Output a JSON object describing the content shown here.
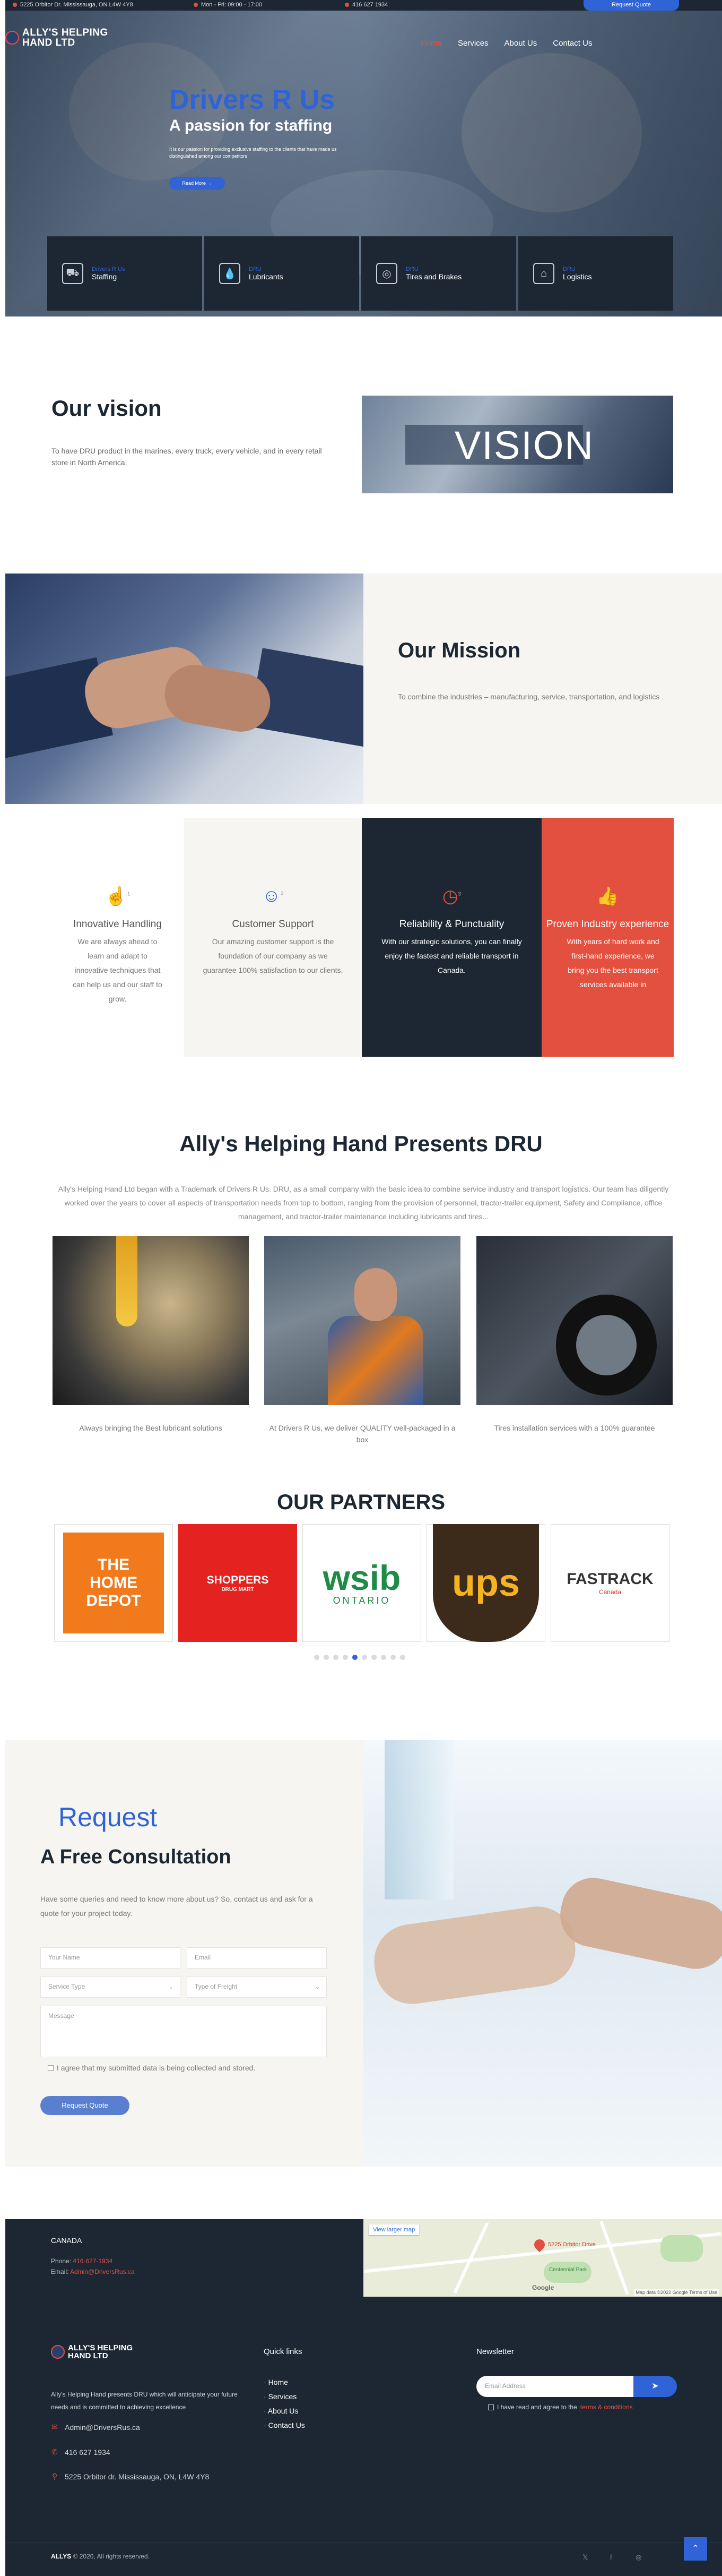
{
  "topbar": {
    "address": "5225 Orbitor Dr. Mississauga, ON L4W 4Y8",
    "hours": "Mon - Fri: 09:00 - 17:00",
    "phone": "416 627 1934",
    "quote_button": "Request Quote"
  },
  "header": {
    "logo_line1": "ALLY'S HELPING",
    "logo_line2": "HAND LTD",
    "nav": [
      "Home",
      "Services",
      "About Us",
      "Contact Us"
    ],
    "active_nav": "Home"
  },
  "hero": {
    "brand": "Drivers R Us",
    "tagline": "A passion for staffing",
    "description": "It is our passion for providing exclusive staffing to the clients that have made us distinguished among our competitors",
    "button": "Read More  →"
  },
  "services": [
    {
      "kicker": "Drivers R Us",
      "name": "Staffing",
      "icon": "truck-icon"
    },
    {
      "kicker": "DRU",
      "name": "Lubricants",
      "icon": "oil-drop-icon"
    },
    {
      "kicker": "DRU",
      "name": "Tires and Brakes",
      "icon": "tire-icon"
    },
    {
      "kicker": "DRU",
      "name": "Logistics",
      "icon": "warehouse-icon"
    }
  ],
  "vision": {
    "title": "Our vision",
    "text": "To have DRU product in the marines, every truck, every vehicle, and in every retail store in North America.",
    "image_word": "VISION"
  },
  "mission": {
    "title": "Our Mission",
    "text": "To combine the industries – manufacturing, service, transportation, and logistics ."
  },
  "features": [
    {
      "title": "Innovative Handling",
      "text": "We are always ahead to learn and adapt to innovative techniques that can help us and our staff to grow.",
      "icon": "hand-icon",
      "number": "1"
    },
    {
      "title": "Customer Support",
      "text": "Our amazing customer support is the foundation of our company as we guarantee 100% satisfaction to our clients.",
      "icon": "user-support-icon",
      "number": "2"
    },
    {
      "title": "Reliability & Punctuality",
      "text": "With our strategic solutions, you can finally enjoy the fastest and reliable transport in Canada.",
      "icon": "clock-icon",
      "number": "3"
    },
    {
      "title": "Proven Industry experience",
      "text": "With years of hard work and first-hand experience, we bring you the best transport services available in",
      "icon": "thumbs-up-icon",
      "number": ""
    }
  ],
  "presents": {
    "title": "Ally's Helping Hand Presents DRU",
    "text": "Ally's Helping Hand Ltd began with a Trademark of Drivers R Us. DRU, as a small company with the basic idea to combine service industry and transport logistics. Our team has diligently worked over the years to cover all aspects of transportation needs from top to bottom, ranging from the provision of personnel, tractor-trailer equipment, Safety and Compliance, office management, and tractor-trailer maintenance including lubricants and tires...",
    "captions": [
      "Always bringing the Best lubricant solutions",
      "At Drivers R Us, we deliver QUALITY well-packaged in a box",
      "Tires installation services with a 100% guarantee"
    ]
  },
  "partners": {
    "title": "OUR PARTNERS",
    "logos": [
      {
        "line1": "THE",
        "line2": "HOME",
        "line3": "DEPOT"
      },
      {
        "line1": "SHOPPERS",
        "line2": "DRUG MART"
      },
      {
        "line1": "wsib",
        "line2": "ONTARIO"
      },
      {
        "line1": "ups"
      },
      {
        "line1": "FASTRACK",
        "line2": "Canada"
      }
    ],
    "dot_count": 10,
    "active_dot": 4
  },
  "request": {
    "small": "Request",
    "big": "A Free Consultation",
    "desc": "Have some queries and need to know more about us? So, contact us and ask for a quote for your project today.",
    "fields": {
      "name": "Your Name",
      "email": "Email",
      "service": "Service Type",
      "freight": "Type of Freight",
      "message": "Message"
    },
    "agree": "I agree that my submitted data is being collected and stored.",
    "button": "Request Quote"
  },
  "contact": {
    "country": "CANADA",
    "phone_label": "Phone:",
    "phone": "416-627-1934",
    "email_label": "Email:",
    "email": "Admin@DriversRus.ca"
  },
  "map": {
    "link": "View larger map",
    "pin_label": "5225 Orbitor Drive",
    "park": "Centennial Park",
    "brand": "Google",
    "attribution": "Map data ©2022 Google   Terms of Use"
  },
  "footer": {
    "logo_line1": "ALLY'S HELPING",
    "logo_line2": "HAND LTD",
    "about": "Ally's Helping Hand presents DRU which will anticipate your future needs and is committed to achieving excellence",
    "email": "Admin@DriversRus.ca",
    "phone": "416 627 1934",
    "address": "5225 Orbitor dr. Mississauga, ON, L4W 4Y8",
    "quick_links_title": "Quick links",
    "quick_links": [
      "Home",
      "Services",
      "About Us",
      "Contact Us"
    ],
    "newsletter_title": "Newsletter",
    "newsletter_placeholder": "Email Address",
    "newsletter_agree": "I have read and agree to the",
    "newsletter_terms": "terms & conditions",
    "copyright_brand": "ALLYS",
    "copyright": "© 2020, All rights reserved."
  },
  "colors": {
    "navy": "#1c2733",
    "blue": "#2f63d6",
    "red": "#e4503f",
    "cream": "#f6f5f1"
  }
}
